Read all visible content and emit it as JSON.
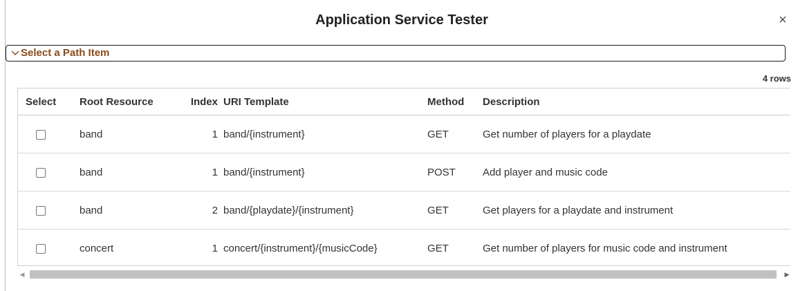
{
  "dialog": {
    "title": "Application Service Tester",
    "close_icon": "close-icon",
    "close_glyph": "×"
  },
  "section": {
    "label": "Select a Path Item",
    "expanded": true,
    "icon": "chevron-down-icon"
  },
  "grid": {
    "row_count_label": "4 rows",
    "columns": {
      "select": "Select",
      "root": "Root Resource",
      "index": "Index",
      "uri": "URI Template",
      "method": "Method",
      "description": "Description"
    },
    "rows": [
      {
        "root": "band",
        "index": "1",
        "uri": "band/{instrument}",
        "method": "GET",
        "description": "Get number of players for a playdate",
        "selected": false
      },
      {
        "root": "band",
        "index": "1",
        "uri": "band/{instrument}",
        "method": "POST",
        "description": "Add player and music code",
        "selected": false
      },
      {
        "root": "band",
        "index": "2",
        "uri": "band/{playdate}/{instrument}",
        "method": "GET",
        "description": "Get players for a playdate and instrument",
        "selected": false
      },
      {
        "root": "concert",
        "index": "1",
        "uri": "concert/{instrument}/{musicCode}",
        "method": "GET",
        "description": "Get number of players for music code and instrument",
        "selected": false
      }
    ]
  },
  "scrollbar": {
    "left_glyph": "◀",
    "right_glyph": "▶"
  },
  "colors": {
    "section_label": "#8a4a1a",
    "border": "#1a1a1a",
    "scroll_thumb": "#c1c1c1"
  }
}
